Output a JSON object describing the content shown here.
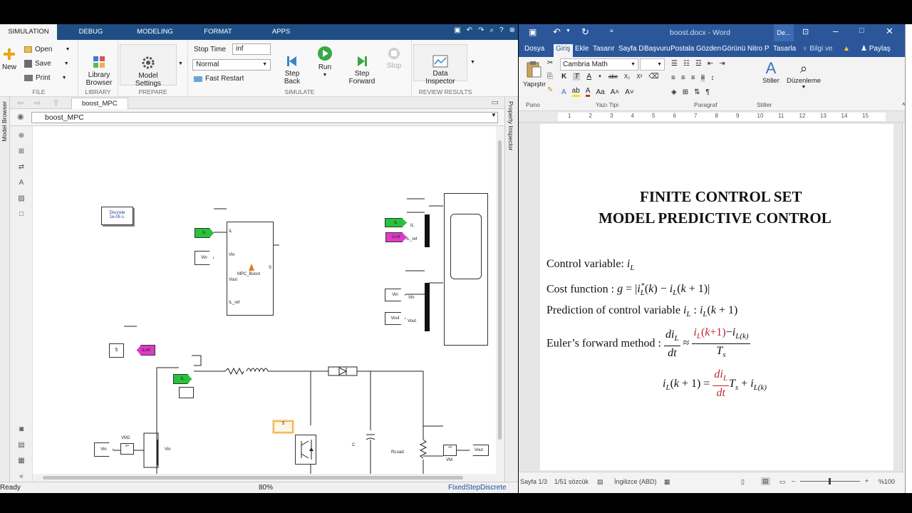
{
  "simulink": {
    "tabs": [
      "SIMULATION",
      "DEBUG",
      "MODELING",
      "FORMAT",
      "APPS"
    ],
    "file": {
      "new": "New",
      "open": "Open",
      "save": "Save",
      "print": "Print",
      "title": "FILE"
    },
    "library": {
      "browser": "Library\nBrowser",
      "title": "LIBRARY"
    },
    "prepare": {
      "model_settings": "Model\nSettings",
      "title": "PREPARE"
    },
    "simulate": {
      "stop_time_label": "Stop Time",
      "stop_time_value": "inf",
      "mode": "Normal",
      "fast_restart": "Fast Restart",
      "step_back": "Step\nBack",
      "run": "Run",
      "step_forward": "Step\nForward",
      "stop": "Stop",
      "title": "SIMULATE"
    },
    "review": {
      "data_inspector": "Data\nInspector",
      "title": "REVIEW RESULTS"
    },
    "doc_tab": "boost_MPC",
    "address": "boost_MPC",
    "model_browser": "Model Browser",
    "property_inspector": "Property Inspector",
    "status": {
      "left": "Ready",
      "zoom": "80%",
      "solver": "FixedStepDiscrete"
    },
    "diagram": {
      "powergui": "Discrete\n1e-05 s.",
      "mpc_block": "MPC_Boost",
      "mpc_ports_in": [
        "IL",
        "Vin",
        "Vout",
        "IL_ref"
      ],
      "mpc_port_out": "S",
      "tag_il": "IL",
      "tag_vin": "Vin",
      "tag_iref": "iLref",
      "tag_vout": "Vout",
      "tag_s": "S",
      "mux_top": [
        "IL",
        "IL_ref"
      ],
      "mux_bottom": [
        "Vin",
        "Vout"
      ],
      "const": "5",
      "vm2": "VM2",
      "vm": "VM",
      "cap": "C",
      "rload": "RLoad",
      "vin_lbl": "Vin"
    }
  },
  "word": {
    "title": "boost.docx - Word",
    "signin": "De...",
    "tabs": [
      "Dosya",
      "Giriş",
      "Ekle",
      "Tasarır",
      "Sayfa D",
      "Başvuru",
      "Postala",
      "Gözden",
      "Görünü",
      "Nitro P",
      "Tasarla"
    ],
    "tell": "Bilgi ve",
    "share": "Paylaş",
    "paste": "Yapıştır",
    "font": "Cambria Math",
    "font_size": "",
    "styles": "Stiller",
    "edit": "Düzenleme",
    "groups": [
      "Pano",
      "Yazı Tipi",
      "Paragraf",
      "Stiller"
    ],
    "ruler": [
      "1",
      "2",
      "3",
      "4",
      "5",
      "6",
      "7",
      "8",
      "9",
      "10",
      "11",
      "12",
      "13",
      "14",
      "15"
    ],
    "doc": {
      "title1": "FINITE CONTROL SET",
      "title2": "MODEL PREDICTIVE CONTROL",
      "l1": "Control variable: ",
      "l2": "Cost function : ",
      "l3": "Prediction of control variable ",
      "l4": "Euler’s forward method : "
    },
    "status": {
      "page": "Sayfa 1/3",
      "words": "1/51 sözcük",
      "lang": "İngilizce (ABD)",
      "zoom": "%100"
    }
  }
}
